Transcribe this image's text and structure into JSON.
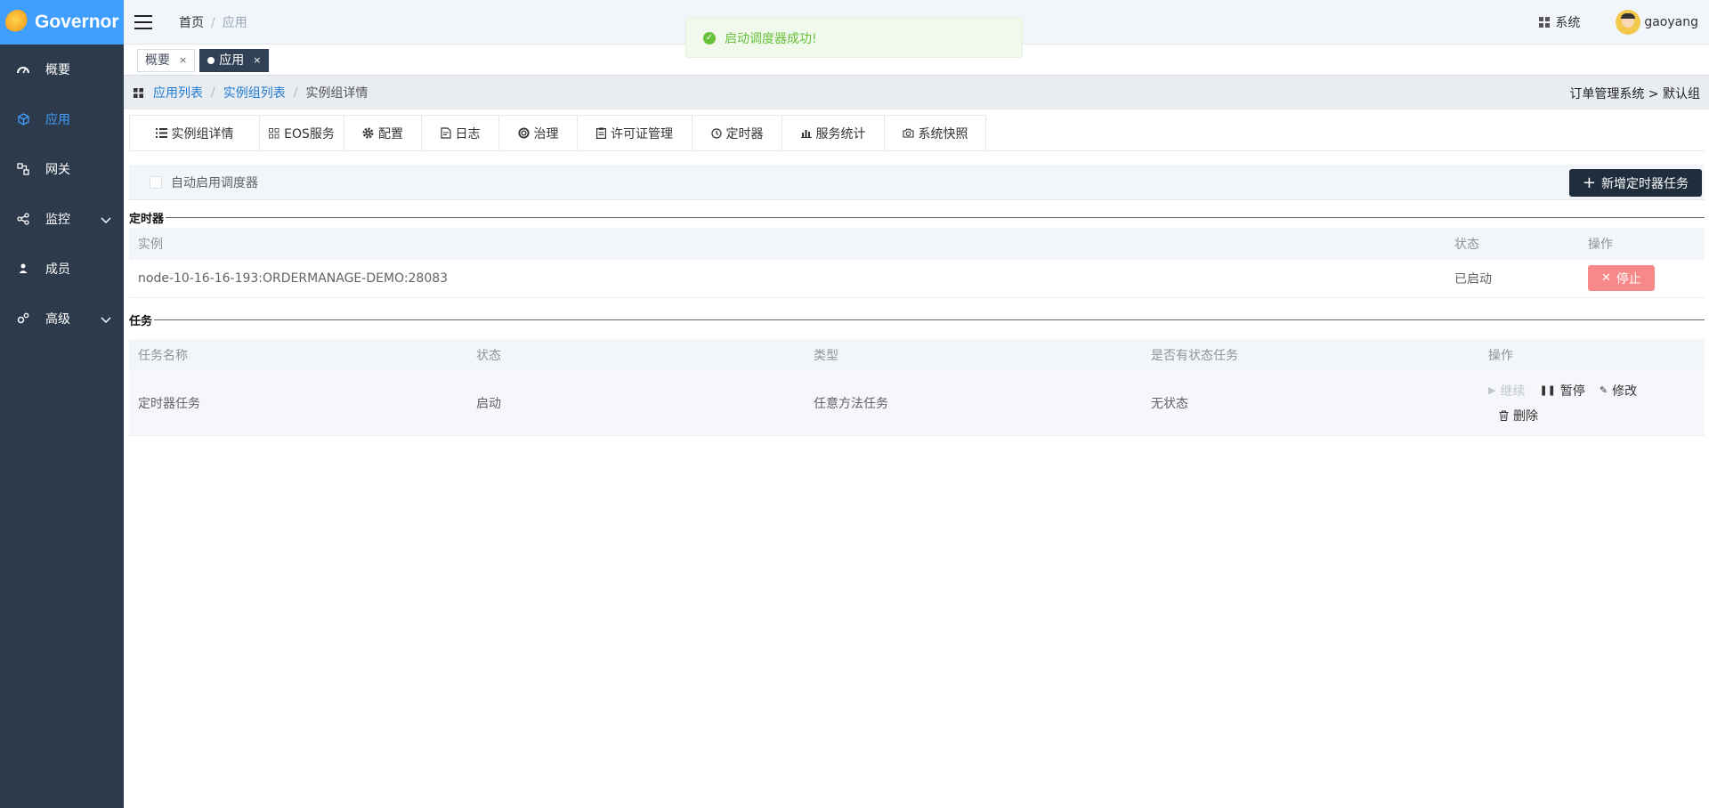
{
  "app": {
    "logo_text": "Governor"
  },
  "sidebar": {
    "items": [
      {
        "label": "概要",
        "icon": "dashboard-icon"
      },
      {
        "label": "应用",
        "icon": "cube-icon",
        "active": true
      },
      {
        "label": "网关",
        "icon": "gateway-icon"
      },
      {
        "label": "监控",
        "icon": "share-icon",
        "expandable": true
      },
      {
        "label": "成员",
        "icon": "user-icon"
      },
      {
        "label": "高级",
        "icon": "gears-icon",
        "expandable": true
      }
    ]
  },
  "header": {
    "crumbs": [
      "首页",
      "应用"
    ],
    "center_title": "",
    "system_label": "系统",
    "username": "gaoyang"
  },
  "toast": {
    "message": "启动调度器成功!"
  },
  "tags": [
    {
      "label": "概要",
      "active": false
    },
    {
      "label": "应用",
      "active": true
    }
  ],
  "subbar": {
    "crumbs": [
      "应用列表",
      "实例组列表",
      "实例组详情"
    ],
    "right_text": "订单管理系统 > 默认组"
  },
  "tabs": [
    {
      "label": "实例组详情",
      "icon": "list-icon"
    },
    {
      "label": "EOS服务",
      "icon": "grid-icon"
    },
    {
      "label": "配置",
      "icon": "gear-icon"
    },
    {
      "label": "日志",
      "icon": "document-icon"
    },
    {
      "label": "治理",
      "icon": "lifebuoy-icon"
    },
    {
      "label": "许可证管理",
      "icon": "clipboard-icon"
    },
    {
      "label": "定时器",
      "icon": "clock-icon",
      "active": true
    },
    {
      "label": "服务统计",
      "icon": "bar-chart-icon"
    },
    {
      "label": "系统快照",
      "icon": "camera-icon"
    }
  ],
  "toolbar": {
    "auto_enable_label": "自动启用调度器",
    "auto_enable_checked": false,
    "add_button_label": "新增定时器任务"
  },
  "timer_section": {
    "title": "定时器",
    "columns": [
      "实例",
      "状态",
      "操作"
    ],
    "rows": [
      {
        "instance": "node-10-16-16-193:ORDERMANAGE-DEMO:28083",
        "status": "已启动",
        "action": "停止"
      }
    ]
  },
  "task_section": {
    "title": "任务",
    "columns": [
      "任务名称",
      "状态",
      "类型",
      "是否有状态任务",
      "操作"
    ],
    "rows": [
      {
        "name": "定时器任务",
        "status": "启动",
        "type": "任意方法任务",
        "stateful": "无状态",
        "ops": {
          "resume": "继续",
          "pause": "暂停",
          "edit": "修改",
          "delete": "删除"
        }
      }
    ]
  },
  "colors": {
    "sidebar_bg": "#2d3a4b",
    "accent": "#409eff",
    "success": "#67c23a",
    "danger_btn": "#f78989",
    "primary_dark": "#1f2d3d"
  }
}
